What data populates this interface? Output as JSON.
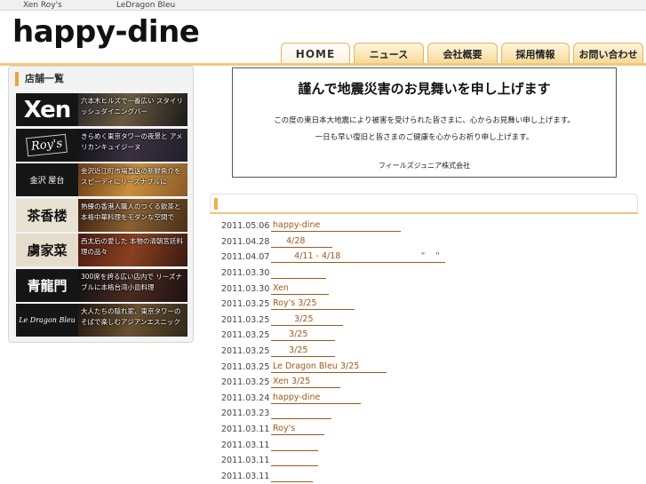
{
  "topbar": {
    "links": [
      "Xen Roy's",
      "LeDragon Bleu"
    ]
  },
  "header": {
    "logo": "happy-dine"
  },
  "tabs": [
    "HOME",
    "ニュース",
    "会社概要",
    "採用情報",
    "お問い合わせ"
  ],
  "sidebar": {
    "title": "店舗一覧",
    "shops": [
      {
        "logo": "Xen",
        "desc": "六本木ヒルズで一番広い スタイリッシュダイニングバー"
      },
      {
        "logo": "Roy's",
        "desc": "きらめく東京タワーの夜景と アメリカンキュイジーヌ"
      },
      {
        "logo": "金沢 屋台",
        "desc": "金沢近江町市場直送の新鮮魚介を スピーディにリーズナブルに"
      },
      {
        "logo": "茶香楼",
        "desc": "熟練の香港人職人のつくる飲茶と 本格中華料理をモダンな空間で"
      },
      {
        "logo": "虜家菜",
        "desc": "西太后の愛した 本物の清朝宮廷料理の品々"
      },
      {
        "logo": "青龍門",
        "desc": "300席を誇る広い店内で リーズナブルに本格台湾小皿料理"
      },
      {
        "logo": "Le Dragon Bleu",
        "desc": "大人たちの隠れ家、東京タワーの そばで楽しむアジアンエスニック"
      }
    ]
  },
  "notice": {
    "title": "謹んで地震災害のお見舞いを申し上げます",
    "line1": "この度の東日本大地震により被害を受けられた皆さまに、心からお見舞い申し上げます。",
    "line2": "一日も早い復旧と皆さまのご健康を心からお祈り申し上げます。",
    "signature": "フィールズジュニア株式会社"
  },
  "news": [
    {
      "date": "2011.05.06",
      "link": "happy-dine                              "
    },
    {
      "date": "2011.04.28",
      "link": "     4/28          "
    },
    {
      "date": "2011.04.07",
      "link": "        4/11 - 4/18                              \"    \"  "
    },
    {
      "date": "2011.03.30",
      "link": "                    "
    },
    {
      "date": "2011.03.30",
      "link": "Xen               "
    },
    {
      "date": "2011.03.25",
      "link": "Roy's 3/25              "
    },
    {
      "date": "2011.03.25",
      "link": "        3/25           "
    },
    {
      "date": "2011.03.25",
      "link": "      3/25          "
    },
    {
      "date": "2011.03.25",
      "link": "      3/25          "
    },
    {
      "date": "2011.03.25",
      "link": "Le Dragon Bleu 3/25          "
    },
    {
      "date": "2011.03.25",
      "link": "Xen 3/25           "
    },
    {
      "date": "2011.03.24",
      "link": "happy-dine               "
    },
    {
      "date": "2011.03.23",
      "link": "                      "
    },
    {
      "date": "2011.03.11",
      "link": "Roy's           "
    },
    {
      "date": "2011.03.11",
      "link": "                 "
    },
    {
      "date": "2011.03.11",
      "link": "                 "
    },
    {
      "date": "2011.03.11",
      "link": "               "
    }
  ]
}
